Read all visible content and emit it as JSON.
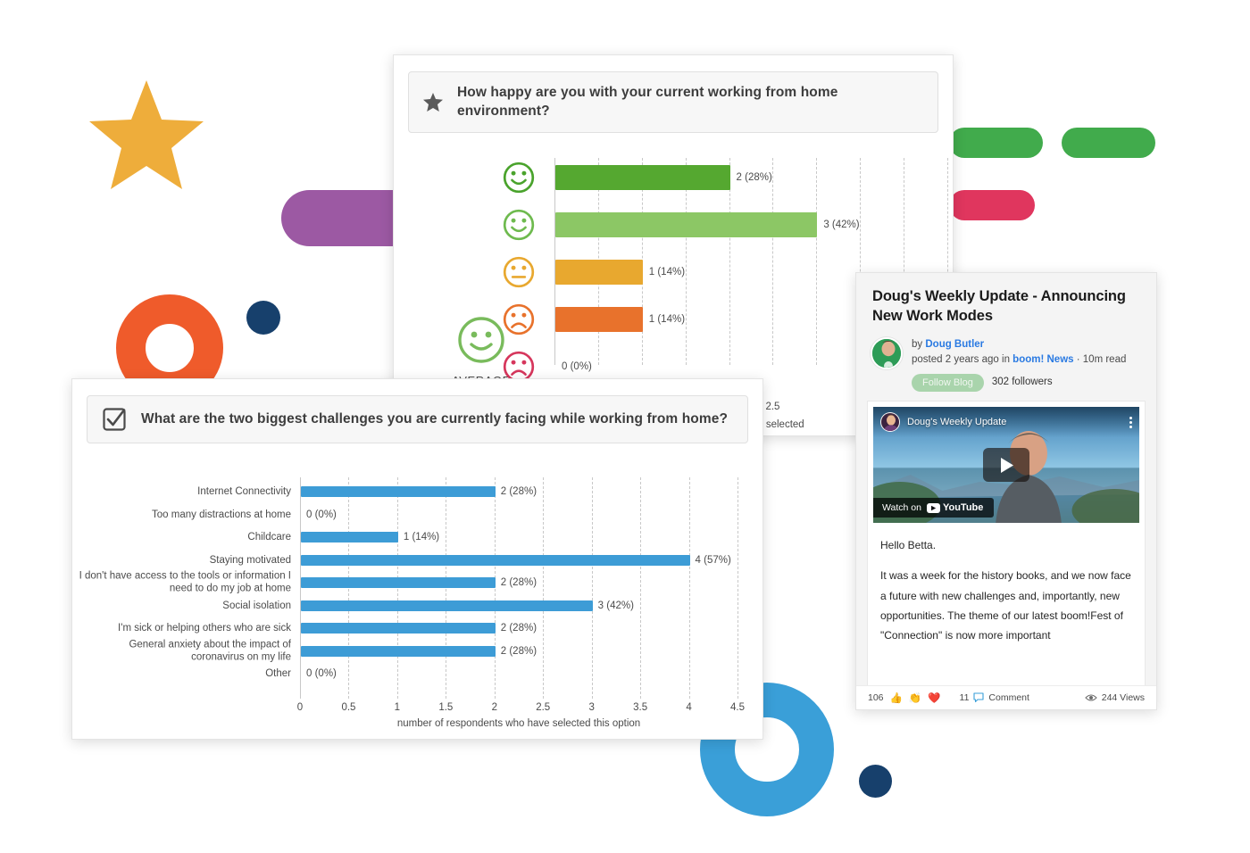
{
  "chart_data": [
    {
      "type": "bar",
      "orientation": "horizontal",
      "title": "How happy are you with your current working from home environment?",
      "title_icon": "star-icon",
      "categories": [
        "very-happy-face",
        "happy-face",
        "neutral-face",
        "sad-face",
        "very-sad-face"
      ],
      "values": [
        2,
        3,
        1,
        1,
        0
      ],
      "value_labels": [
        "2 (28%)",
        "3 (42%)",
        "1 (14%)",
        "1 (14%)",
        "0 (0%)"
      ],
      "bar_colors": [
        "#55a830",
        "#8cc765",
        "#e8a82f",
        "#e8722c",
        "#ffffff"
      ],
      "face_colors": [
        "#4aa32c",
        "#6eba4e",
        "#e8a82f",
        "#e8722c",
        "#d6365c"
      ],
      "xlim": [
        0,
        4.5
      ],
      "xticks": [
        "2.5"
      ],
      "xlabel": "who have selected",
      "grid": true,
      "average": {
        "label": "AVERAGE",
        "face": "happy-face",
        "color": "#79bb5c"
      }
    },
    {
      "type": "bar",
      "orientation": "horizontal",
      "title": "What are  the  two  biggest  challenges  you  are  currently facing  while  working  from home?",
      "title_icon": "checkbox-icon",
      "categories": [
        "Internet Connectivity",
        "Too many distractions at home",
        "Childcare",
        "Staying motivated",
        "I don't have access to the tools or information I need to do my job at home",
        "Social isolation",
        "I'm sick or helping others who are sick",
        "General anxiety about the impact of coronavirus on my life",
        "Other"
      ],
      "values": [
        2,
        0,
        1,
        4,
        2,
        3,
        2,
        2,
        0
      ],
      "value_labels": [
        "2 (28%)",
        "0 (0%)",
        "1 (14%)",
        "4 (57%)",
        "2 (28%)",
        "3 (42%)",
        "2 (28%)",
        "2 (28%)",
        "0 (0%)"
      ],
      "bar_color": "#3d9cd6",
      "xlim": [
        0,
        4.5
      ],
      "xticks": [
        "0",
        "0.5",
        "1",
        "1.5",
        "2",
        "2.5",
        "3",
        "3.5",
        "4",
        "4.5"
      ],
      "xlabel": "number of respondents who have selected this option",
      "grid": true
    }
  ],
  "blog": {
    "title": "Doug's Weekly Update - Announcing New Work Modes",
    "by_prefix": "by",
    "author": "Doug Butler",
    "posted_prefix": "posted 2 years ago in",
    "blog_name": "boom! News",
    "read_time": "· 10m read",
    "follow_label": "Follow Blog",
    "followers": "302 followers",
    "video": {
      "title": "Doug's Weekly Update",
      "watch_on": "Watch on",
      "youtube": "YouTube"
    },
    "body": [
      "Hello Betta.",
      "It was a week for the history books, and we now face a future with new challenges and, importantly, new opportunities.  The theme of our latest boom!Fest of \"Connection\" is now more important"
    ],
    "footer": {
      "reaction_count": "106",
      "reactions": [
        "👍",
        "👏",
        "❤️"
      ],
      "comment_count": "11",
      "comment_label": "Comment",
      "views": "244 Views"
    }
  },
  "decor": {
    "star_color": "#eead3b",
    "purple": "#9c59a3",
    "green": "#41ab4c",
    "pink": "#e0365e",
    "orange": "#ef5b2b",
    "blue": "#3a9fd8",
    "navy": "#17406c"
  }
}
